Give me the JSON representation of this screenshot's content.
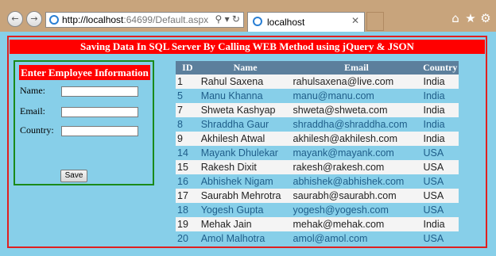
{
  "browser": {
    "address": {
      "host": "http://localhost",
      "path": ":64699/Default.aspx"
    },
    "tab": {
      "title": "localhost"
    }
  },
  "page": {
    "header": "Saving Data In SQL Server By Calling WEB Method using jQuery & JSON",
    "form": {
      "title": "Enter Employee Information",
      "name_label": "Name:",
      "email_label": "Email:",
      "country_label": "Country:",
      "name_value": "",
      "email_value": "",
      "country_value": "",
      "save_label": "Save"
    },
    "table": {
      "headers": [
        "ID",
        "Name",
        "Email",
        "Country"
      ],
      "rows": [
        [
          "1",
          "Rahul Saxena",
          "rahulsaxena@live.com",
          "India"
        ],
        [
          "5",
          "Manu Khanna",
          "manu@manu.com",
          "India"
        ],
        [
          "7",
          "Shweta Kashyap",
          "shweta@shweta.com",
          "India"
        ],
        [
          "8",
          "Shraddha Gaur",
          "shraddha@shraddha.com",
          "India"
        ],
        [
          "9",
          "Akhilesh Atwal",
          "akhilesh@akhilesh.com",
          "India"
        ],
        [
          "14",
          "Mayank Dhulekar",
          "mayank@mayank.com",
          "USA"
        ],
        [
          "15",
          "Rakesh Dixit",
          "rakesh@rakesh.com",
          "USA"
        ],
        [
          "16",
          "Abhishek Nigam",
          "abhishek@abhishek.com",
          "USA"
        ],
        [
          "17",
          "Saurabh Mehrotra",
          "saurabh@saurabh.com",
          "USA"
        ],
        [
          "18",
          "Yogesh Gupta",
          "yogesh@yogesh.com",
          "USA"
        ],
        [
          "19",
          "Mehak Jain",
          "mehak@mehak.com",
          "India"
        ],
        [
          "20",
          "Amol Malhotra",
          "amol@amol.com",
          "USA"
        ]
      ]
    }
  }
}
